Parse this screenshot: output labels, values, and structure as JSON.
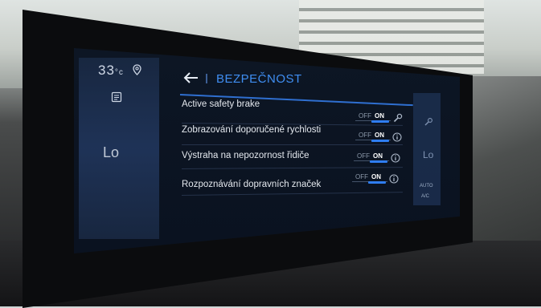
{
  "status": {
    "temperature": "33",
    "temperature_unit": "°c"
  },
  "left_panel": {
    "level": "Lo"
  },
  "header": {
    "back_icon": "arrow-left-icon",
    "title": "BEZPEČNOST"
  },
  "settings": [
    {
      "label": "Active safety brake",
      "toggle_off": "OFF",
      "toggle_on": "ON",
      "state": "on",
      "icon": "wrench-icon"
    },
    {
      "label": "Zobrazování doporučené rychlosti",
      "toggle_off": "OFF",
      "toggle_on": "ON",
      "state": "on",
      "icon": "info-icon"
    },
    {
      "label": "Výstraha na nepozornost řidiče",
      "toggle_off": "OFF",
      "toggle_on": "ON",
      "state": "on",
      "icon": "info-icon"
    },
    {
      "label": "Rozpoznávání dopravních značek",
      "toggle_off": "OFF",
      "toggle_on": "ON",
      "state": "on",
      "icon": "info-icon"
    }
  ],
  "right_panel": {
    "level": "Lo",
    "auto_label": "AUTO",
    "ac_label": "A/C"
  },
  "colors": {
    "accent": "#2f7df0",
    "title": "#3f8ef2",
    "screen_bg": "#0a1220"
  }
}
